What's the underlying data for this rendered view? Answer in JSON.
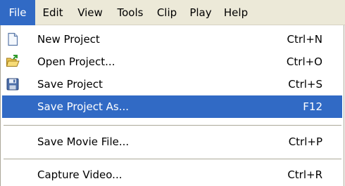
{
  "menubar": {
    "items": [
      {
        "label": "File"
      },
      {
        "label": "Edit"
      },
      {
        "label": "View"
      },
      {
        "label": "Tools"
      },
      {
        "label": "Clip"
      },
      {
        "label": "Play"
      },
      {
        "label": "Help"
      }
    ],
    "active_index": 0
  },
  "file_menu": {
    "items": [
      {
        "label": "New Project",
        "shortcut": "Ctrl+N",
        "icon": "new-document-icon"
      },
      {
        "label": "Open Project...",
        "shortcut": "Ctrl+O",
        "icon": "open-folder-icon"
      },
      {
        "label": "Save Project",
        "shortcut": "Ctrl+S",
        "icon": "floppy-disk-icon"
      },
      {
        "label": "Save Project As...",
        "shortcut": "F12",
        "icon": ""
      },
      {
        "label": "Save Movie File...",
        "shortcut": "Ctrl+P",
        "icon": ""
      },
      {
        "label": "Capture Video...",
        "shortcut": "Ctrl+R",
        "icon": ""
      }
    ],
    "highlighted_index": 3
  },
  "colors": {
    "highlight": "#316ac5",
    "menubar_bg": "#ece9d8",
    "separator": "#aca899"
  }
}
